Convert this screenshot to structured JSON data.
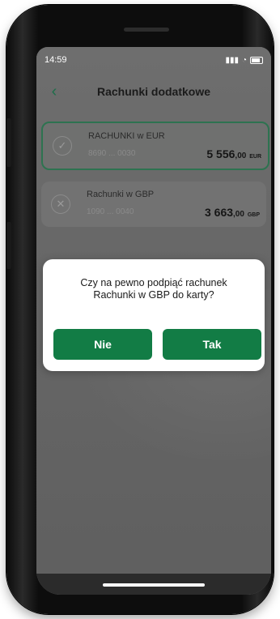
{
  "status_bar": {
    "time": "14:59"
  },
  "header": {
    "title": "Rachunki dodatkowe"
  },
  "accounts": [
    {
      "name": "RACHUNKI w EUR",
      "number": "8690 ... 0030",
      "balance_main": "5 556",
      "balance_decimal": ",00",
      "currency": "EUR",
      "selected": true
    },
    {
      "name": "Rachunki w GBP",
      "number": "1090 ... 0040",
      "balance_main": "3 663",
      "balance_decimal": ",00",
      "currency": "GBP",
      "selected": false
    }
  ],
  "dialog": {
    "message_line1": "Czy na pewno podpiąć rachunek",
    "message_line2": "Rachunki w GBP do karty?",
    "no_label": "Nie",
    "yes_label": "Tak"
  },
  "colors": {
    "accent": "#127c45",
    "selected_border": "#2d7350"
  }
}
